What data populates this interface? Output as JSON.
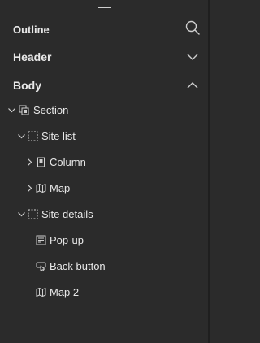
{
  "panel": {
    "title": "Outline",
    "search_icon": "search-icon"
  },
  "sections": {
    "header": {
      "label": "Header",
      "expanded": false
    },
    "body": {
      "label": "Body",
      "expanded": true
    }
  },
  "tree": {
    "section": {
      "label": "Section",
      "icon": "section-icon",
      "expanded": true
    },
    "site_list": {
      "label": "Site list",
      "icon": "block-icon",
      "expanded": true
    },
    "column": {
      "label": "Column",
      "icon": "column-icon",
      "expanded": false
    },
    "map": {
      "label": "Map",
      "icon": "map-icon",
      "expanded": false
    },
    "site_details": {
      "label": "Site details",
      "icon": "block-icon",
      "expanded": true
    },
    "popup": {
      "label": "Pop-up",
      "icon": "popup-icon"
    },
    "back_button": {
      "label": "Back button",
      "icon": "button-icon"
    },
    "map2": {
      "label": "Map 2",
      "icon": "map-icon"
    }
  },
  "colors": {
    "background": "#2b2b2b",
    "text": "#e8e8e8",
    "icon": "#cfcfcf"
  }
}
